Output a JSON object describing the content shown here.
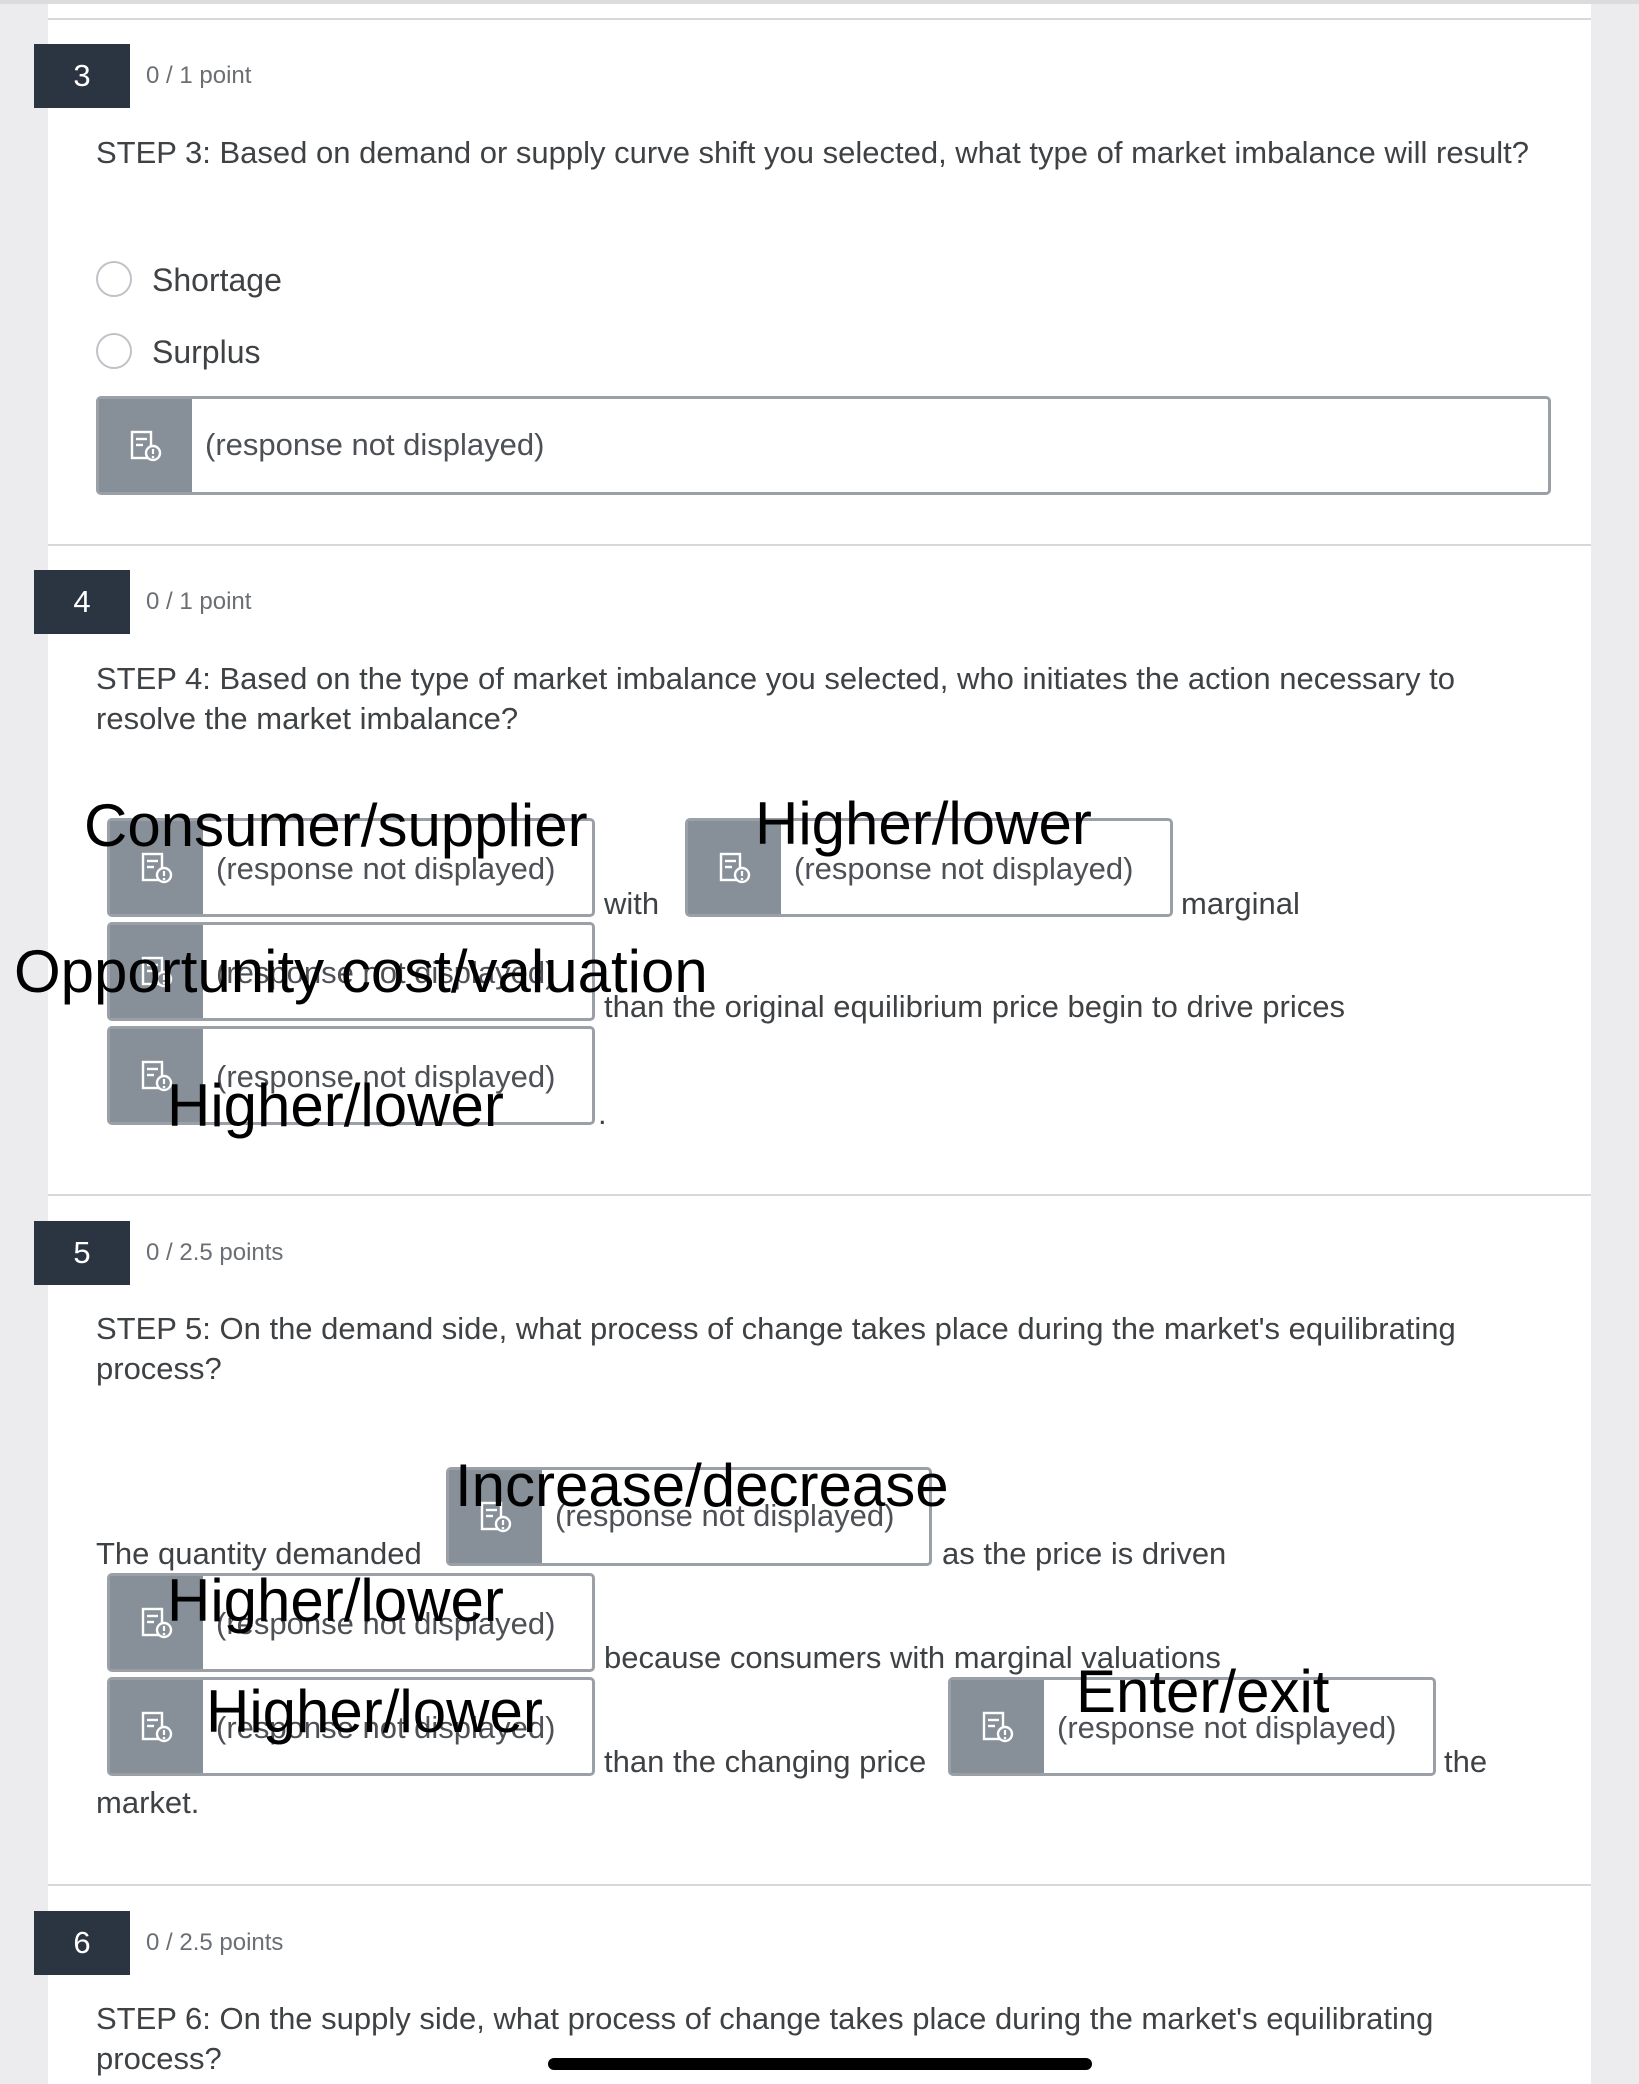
{
  "questions": [
    {
      "number": "3",
      "points": "0 / 1 point",
      "text": "STEP 3:   Based on demand or supply curve shift you selected, what type of market imbalance will result?",
      "options": [
        "Shortage",
        "Surplus"
      ],
      "response": "(response not displayed)"
    },
    {
      "number": "4",
      "points": "0 / 1 point",
      "text": "STEP 4:   Based on the type of market imbalance you selected, who initiates the action necessary to resolve the market imbalance?",
      "fill": {
        "resp1": "(response not displayed)",
        "word_with": "with",
        "resp2": "(response not displayed)",
        "word_marginal": "marginal",
        "resp3": "(response not displayed)",
        "phrase": "than the original equilibrium price begin to drive prices",
        "resp4": "(response not displayed)",
        "period": "."
      },
      "labels": {
        "consumer_supplier": "Consumer/supplier",
        "higher_lower_1": "Higher/lower",
        "opportunity": "Opportunity cost/valuation",
        "higher_lower_2": "Higher/lower"
      }
    },
    {
      "number": "5",
      "points": "0 / 2.5 points",
      "text": "STEP 5:   On the demand side, what process of change takes place during the market's equilibrating process?",
      "fill": {
        "lead": "The quantity demanded",
        "resp1": "(response not displayed)",
        "phrase1": "as the price is driven",
        "resp2": "(response not displayed)",
        "phrase2": "because consumers with marginal valuations",
        "resp3": "(response not displayed)",
        "phrase3": "than the changing price",
        "resp4": "(response not displayed)",
        "word_the": "the",
        "word_market": "market."
      },
      "labels": {
        "increase_decrease": "Increase/decrease",
        "higher_lower_1": "Higher/lower",
        "higher_lower_2": "Higher/lower",
        "enter_exit": "Enter/exit"
      }
    },
    {
      "number": "6",
      "points": "0 / 2.5 points",
      "text": "STEP 6:   On the supply side, what process of change takes place during the market's equilibrating process?"
    }
  ],
  "colors": {
    "number_badge": "#2b3542",
    "response_icon_bg": "#878f98",
    "response_border": "#9aa0a6"
  },
  "icons": {
    "response": "response-unavailable-icon"
  }
}
